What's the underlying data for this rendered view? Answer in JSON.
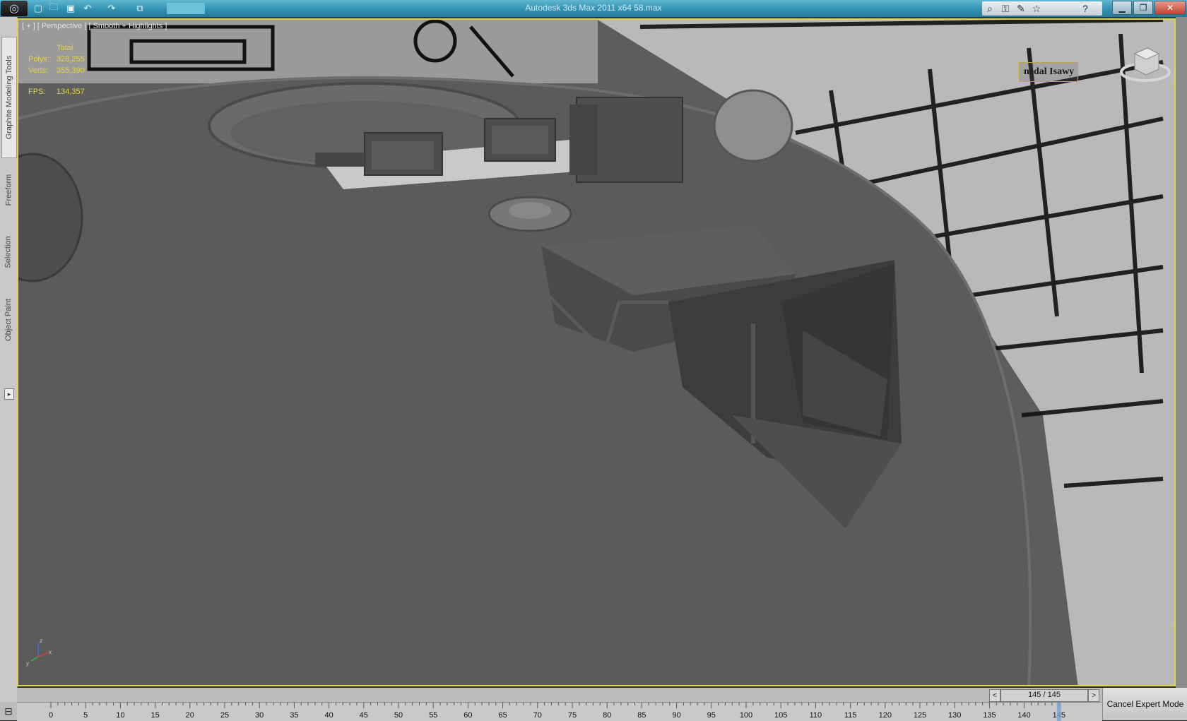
{
  "titlebar": {
    "title": "Autodesk 3ds Max  2011 x64      58.max",
    "quick_access": [
      "new-file-icon",
      "open-file-icon",
      "save-icon",
      "undo-icon",
      "redo-icon",
      "project-folder-icon"
    ],
    "infocenter_icons": [
      "binoculars-icon",
      "key-icon",
      "tools-icon",
      "star-icon"
    ],
    "help": "?",
    "window_controls": {
      "minimize": "▁",
      "maximize": "❐",
      "close": "✕"
    }
  },
  "left_tabs": [
    "Graphite Modeling Tools",
    "Freeform",
    "Selection",
    "Object Paint"
  ],
  "viewport": {
    "label": "[ + ] [ Perspective ] [ Smooth + Highlights ]",
    "stats": {
      "header": "Total",
      "polys_label": "Polys:",
      "polys": "328,255",
      "verts_label": "Verts:",
      "verts": "355,390",
      "fps_label": "FPS:",
      "fps": "134,357"
    },
    "watermark": "nedal Isawy",
    "accent_color": "#e0d64a"
  },
  "time_slider": {
    "frame_label": "145 / 145",
    "current_frame": 145,
    "total_frames": 145,
    "prev": "<",
    "next": ">"
  },
  "track_bar": {
    "ticks": [
      "0",
      "5",
      "10",
      "15",
      "20",
      "25",
      "30",
      "35",
      "40",
      "45",
      "50",
      "55",
      "60",
      "65",
      "70",
      "75",
      "80",
      "85",
      "90",
      "95",
      "100",
      "105",
      "110",
      "115",
      "120",
      "125",
      "130",
      "135",
      "140",
      "145"
    ]
  },
  "cancel_expert_label": "Cancel Expert Mode"
}
